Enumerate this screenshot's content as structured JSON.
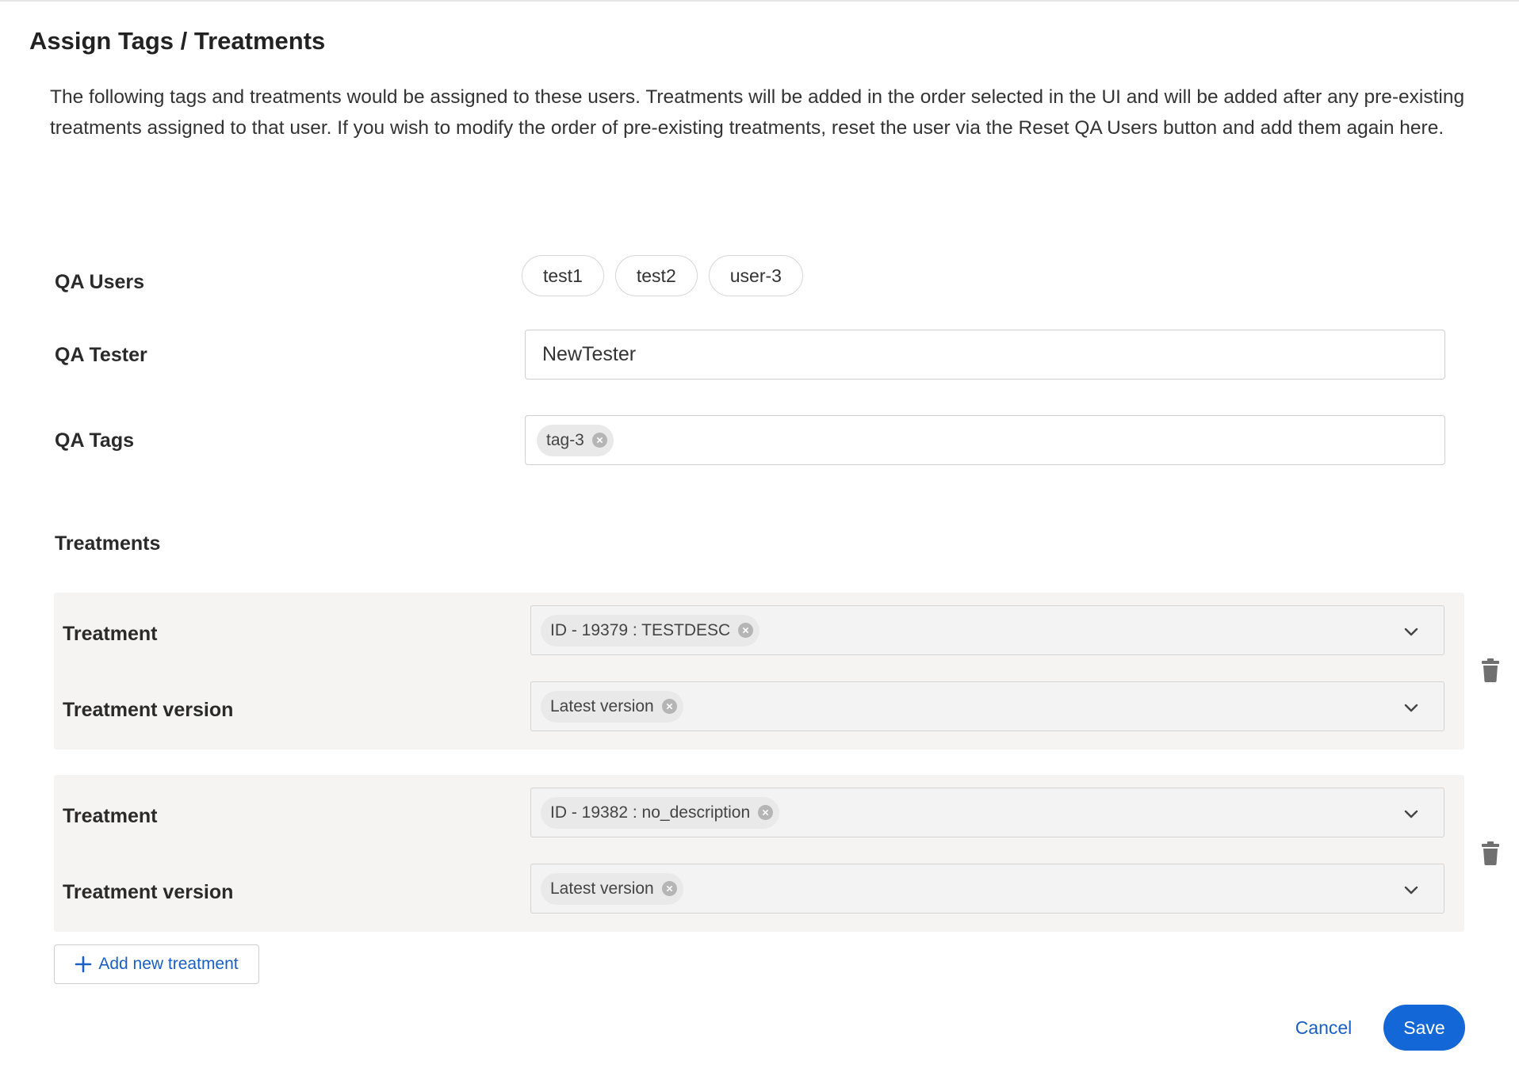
{
  "dialog": {
    "title": "Assign Tags / Treatments",
    "description": "The following tags and treatments would be assigned to these users. Treatments will be added in the order selected in the UI and will be added after any pre-existing treatments assigned to that user. If you wish to modify the order of pre-existing treatments, reset the user via the Reset QA Users button and add them again here."
  },
  "qa_users": {
    "label": "QA Users",
    "users": [
      "test1",
      "test2",
      "user-3"
    ]
  },
  "qa_tester": {
    "label": "QA Tester",
    "value": "NewTester"
  },
  "qa_tags": {
    "label": "QA Tags",
    "tags": [
      "tag-3"
    ]
  },
  "treatments": {
    "section_title": "Treatments",
    "treatment_label": "Treatment",
    "version_label": "Treatment version",
    "items": [
      {
        "treatment": "ID - 19379 : TESTDESC",
        "version": "Latest version"
      },
      {
        "treatment": "ID - 19382 : no_description",
        "version": "Latest version"
      }
    ]
  },
  "actions": {
    "add_treatment": "Add new treatment",
    "cancel": "Cancel",
    "save": "Save"
  },
  "icons": {
    "remove": "close-circle-icon",
    "dropdown": "chevron-down-icon",
    "delete": "trash-icon",
    "add": "plus-icon"
  },
  "colors": {
    "primary": "#1467d6",
    "link": "#1a5fc4",
    "treatment_bg": "#f5f4f3"
  }
}
